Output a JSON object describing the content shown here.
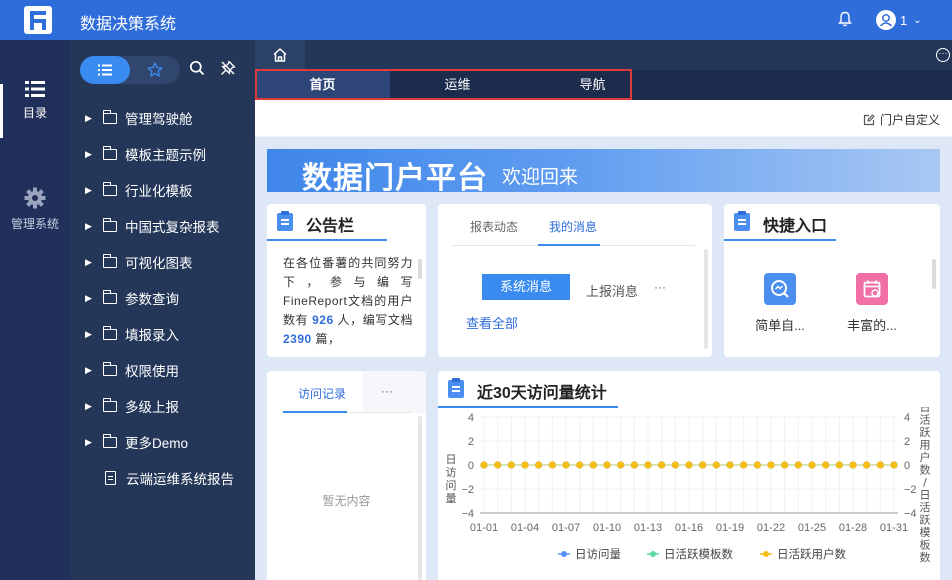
{
  "app": {
    "title": "数据决策系统",
    "user_name": "1"
  },
  "leftnav": [
    {
      "label": "目录",
      "icon": "list-icon",
      "active": true
    },
    {
      "label": "管理系统",
      "icon": "gear-icon",
      "active": false
    }
  ],
  "tree": {
    "items": [
      {
        "label": "管理驾驶舱",
        "type": "folder"
      },
      {
        "label": "模板主题示例",
        "type": "folder"
      },
      {
        "label": "行业化模板",
        "type": "folder"
      },
      {
        "label": "中国式复杂报表",
        "type": "folder"
      },
      {
        "label": "可视化图表",
        "type": "folder"
      },
      {
        "label": "参数查询",
        "type": "folder"
      },
      {
        "label": "填报录入",
        "type": "folder"
      },
      {
        "label": "权限使用",
        "type": "folder"
      },
      {
        "label": "多级上报",
        "type": "folder"
      },
      {
        "label": "更多Demo",
        "type": "folder"
      },
      {
        "label": "云端运维系统报告",
        "type": "file"
      }
    ]
  },
  "subtabs": [
    {
      "label": "首页",
      "active": true
    },
    {
      "label": "运维",
      "active": false
    },
    {
      "label": "导航",
      "active": false
    }
  ],
  "toolbar": {
    "customize_label": "门户自定义"
  },
  "banner": {
    "title": "数据门户平台",
    "subtitle": "欢迎回来"
  },
  "notice": {
    "title": "公告栏",
    "text_1": "在各位番薯的共同努力下，参与编写FineReport文档的用户数有",
    "count_1": "926",
    "text_2": "人，编写文档",
    "count_2": "2390",
    "text_3": "篇，"
  },
  "messages": {
    "tabs": [
      "报表动态",
      "我的消息"
    ],
    "active_tab": "我的消息",
    "system_btn": "系统消息",
    "report_btn": "上报消息",
    "more": "···",
    "view_all": "查看全部"
  },
  "quick": {
    "title": "快捷入口",
    "items": [
      {
        "label": "简单自...",
        "color": "#4a8ef0",
        "icon": "search-chart-icon"
      },
      {
        "label": "丰富的...",
        "color": "#f06fa5",
        "icon": "calendar-icon"
      }
    ]
  },
  "visits": {
    "tab": "访问记录",
    "more": "···",
    "empty": "暂无内容"
  },
  "chart_data": {
    "type": "line",
    "title": "近30天访问量统计",
    "ylabel": "日访问量",
    "y2label": "日活跃用户数/日活跃模板数",
    "ylim": [
      -4,
      4
    ],
    "y2lim": [
      -4,
      4
    ],
    "yticks": [
      "4",
      "2",
      "0",
      "−2",
      "−4"
    ],
    "x": [
      "01-01",
      "01-02",
      "01-03",
      "01-04",
      "01-05",
      "01-06",
      "01-07",
      "01-08",
      "01-09",
      "01-10",
      "01-11",
      "01-12",
      "01-13",
      "01-14",
      "01-15",
      "01-16",
      "01-17",
      "01-18",
      "01-19",
      "01-20",
      "01-21",
      "01-22",
      "01-23",
      "01-24",
      "01-25",
      "01-26",
      "01-27",
      "01-28",
      "01-29",
      "01-30",
      "01-31"
    ],
    "xtick_labels": [
      "01-01",
      "01-04",
      "01-07",
      "01-10",
      "01-13",
      "01-16",
      "01-19",
      "01-22",
      "01-25",
      "01-28",
      "01-31"
    ],
    "series": [
      {
        "name": "日访问量",
        "color": "#5b8ff9",
        "values": [
          0,
          0,
          0,
          0,
          0,
          0,
          0,
          0,
          0,
          0,
          0,
          0,
          0,
          0,
          0,
          0,
          0,
          0,
          0,
          0,
          0,
          0,
          0,
          0,
          0,
          0,
          0,
          0,
          0,
          0,
          0
        ]
      },
      {
        "name": "日活跃模板数",
        "color": "#5ad8a6",
        "values": [
          0,
          0,
          0,
          0,
          0,
          0,
          0,
          0,
          0,
          0,
          0,
          0,
          0,
          0,
          0,
          0,
          0,
          0,
          0,
          0,
          0,
          0,
          0,
          0,
          0,
          0,
          0,
          0,
          0,
          0,
          0
        ]
      },
      {
        "name": "日活跃用户数",
        "color": "#f6bd16",
        "values": [
          0,
          0,
          0,
          0,
          0,
          0,
          0,
          0,
          0,
          0,
          0,
          0,
          0,
          0,
          0,
          0,
          0,
          0,
          0,
          0,
          0,
          0,
          0,
          0,
          0,
          0,
          0,
          0,
          0,
          0,
          0
        ]
      }
    ],
    "grid": true,
    "legend": "bottom"
  },
  "colors": {
    "brand": "#2f6ddb",
    "accent": "#3a8bf0",
    "sidebar": "#20305a",
    "highlight_box": "#e03b3b"
  }
}
